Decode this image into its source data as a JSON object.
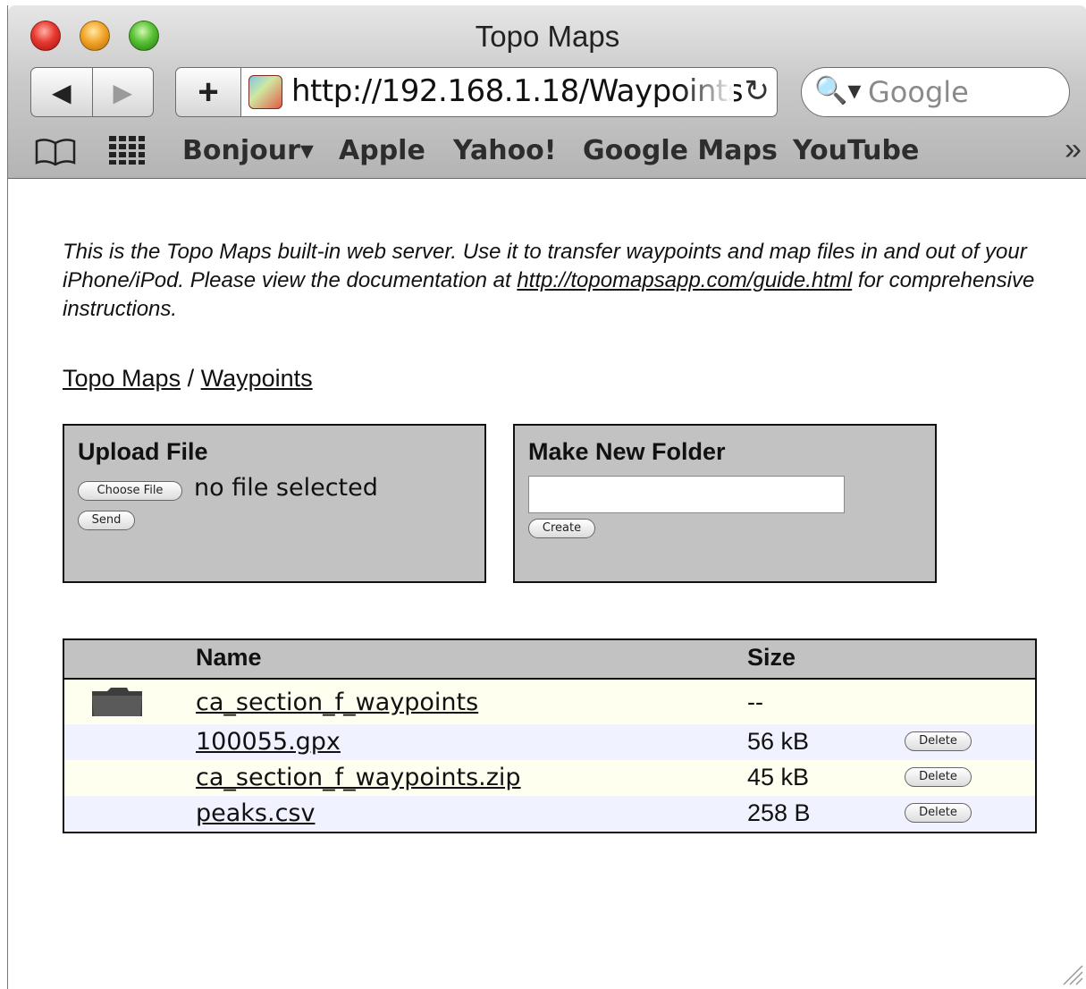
{
  "window": {
    "title": "Topo Maps"
  },
  "toolbar": {
    "back_icon": "◀",
    "forward_icon": "▶",
    "add_icon": "+",
    "url": "http://192.168.1.18/Waypoints",
    "reload_icon": "↻",
    "search_icon": "🔍▾",
    "search_placeholder": "Google"
  },
  "bookmarks": {
    "items": [
      "Bonjour▾",
      "Apple",
      "Yahoo!",
      "Google Maps",
      "YouTube"
    ],
    "more": "»"
  },
  "page": {
    "intro_text": "This is the Topo Maps built-in web server. Use it to transfer waypoints and map files in and out of your iPhone/iPod. Please view the documentation at",
    "intro_link": "http://topomapsapp.com/guide.html",
    "intro_tail": "for comprehensive instructions.",
    "breadcrumb": {
      "root": "Topo Maps",
      "separator": "/",
      "current": "Waypoints"
    },
    "upload": {
      "title": "Upload File",
      "choose_label": "Choose File",
      "status": "no file selected",
      "send_label": "Send"
    },
    "new_folder": {
      "title": "Make New Folder",
      "input_value": "",
      "create_label": "Create"
    },
    "table": {
      "headers": {
        "name": "Name",
        "size": "Size"
      },
      "rows": [
        {
          "type": "folder",
          "name": "ca_section_f_waypoints",
          "size": "--",
          "action": ""
        },
        {
          "type": "file",
          "name": "100055.gpx",
          "size": "56 kB",
          "action": "Delete"
        },
        {
          "type": "file",
          "name": "ca_section_f_waypoints.zip",
          "size": "45 kB",
          "action": "Delete"
        },
        {
          "type": "file",
          "name": "peaks.csv",
          "size": "258 B",
          "action": "Delete"
        }
      ]
    }
  }
}
